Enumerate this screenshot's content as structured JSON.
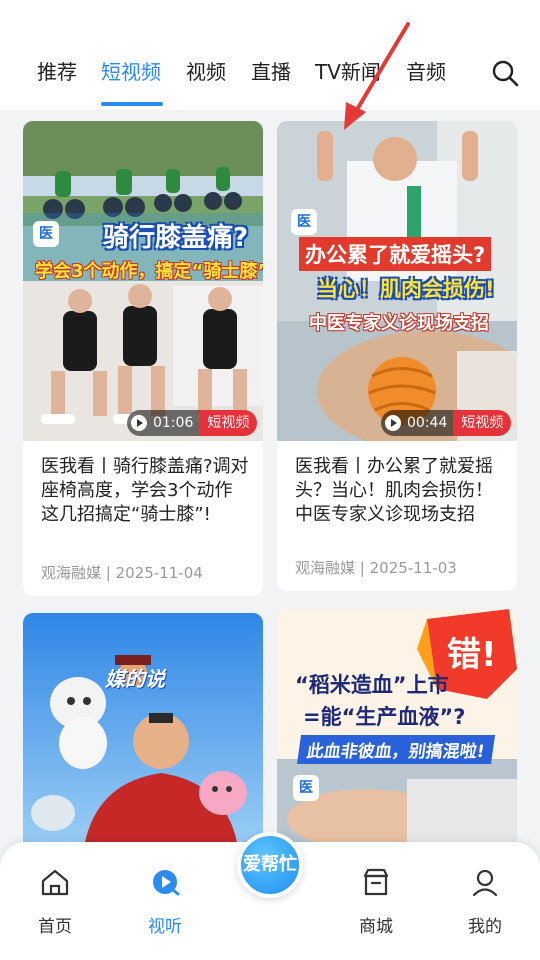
{
  "tabs": [
    {
      "label": "推荐",
      "active": false
    },
    {
      "label": "短视频",
      "active": true
    },
    {
      "label": "视频",
      "active": false
    },
    {
      "label": "直播",
      "active": false
    },
    {
      "label": "TV新闻",
      "active": false
    },
    {
      "label": "音频",
      "active": false
    }
  ],
  "search": {
    "icon": "search-icon"
  },
  "cards": [
    {
      "title": "医我看丨骑行膝盖痛?调对座椅高度，学会3个动作 这几招搞定“骑士膝”!",
      "source": "观海融媒",
      "date": "2025-11-04",
      "duration": "01:06",
      "tag": "短视频",
      "thumb_text": {
        "line1": "骑行膝盖痛?",
        "line2": "学会3个动作，搞定“骑士膝”",
        "logo": "医"
      }
    },
    {
      "title": "医我看丨办公累了就爱摇头？当心！肌肉会损伤！中医专家义诊现场支招",
      "source": "观海融媒",
      "date": "2025-11-03",
      "duration": "00:44",
      "tag": "短视频",
      "thumb_text": {
        "line1": "办公累了就爱摇头?",
        "line2": "当心！肌肉会损伤!",
        "line3": "中医专家义诊现场支招",
        "logo": "医"
      }
    },
    {
      "thumb_text": {
        "line1": "媒的说"
      }
    },
    {
      "thumb_text": {
        "burst": "错!",
        "line1": "“稻米造血”上市",
        "line2": "=能“生产血液”?",
        "line3": "此血非彼血，别搞混啦!",
        "logo": "医"
      }
    }
  ],
  "meta_separator": " | ",
  "bottom_nav": [
    {
      "label": "首页",
      "icon": "home-icon",
      "active": false
    },
    {
      "label": "视听",
      "icon": "play-circle-icon",
      "active": true
    },
    {
      "label": "商城",
      "icon": "store-icon",
      "active": false
    },
    {
      "label": "我的",
      "icon": "user-icon",
      "active": false
    }
  ],
  "center_button": {
    "label": "爱帮忙"
  },
  "colors": {
    "accent": "#2a8cf0",
    "tag_red": "#e8323a",
    "annotation_arrow": "#e53935"
  }
}
